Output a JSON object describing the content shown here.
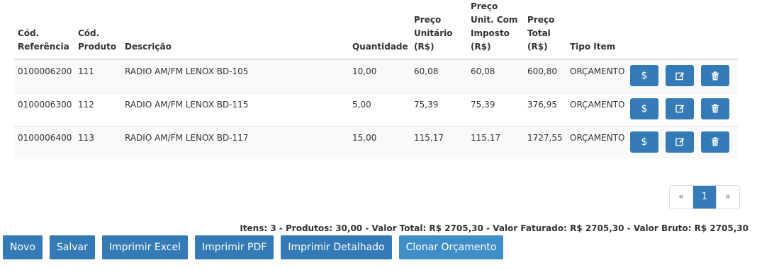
{
  "table": {
    "headers": {
      "ref": [
        "Cód.",
        "Referência"
      ],
      "prod": [
        "Cód.",
        "Produto"
      ],
      "desc": [
        "Descrição"
      ],
      "qty": [
        "Quantidade"
      ],
      "unit": [
        "Preço",
        "Unitário",
        "(R$)"
      ],
      "unit_tax": [
        "Preço",
        "Unit. Com",
        "Imposto",
        "(R$)"
      ],
      "total": [
        "Preço",
        "Total",
        "(R$)"
      ],
      "type": [
        "Tipo Item"
      ]
    },
    "rows": [
      {
        "ref": "0100006200",
        "prod": "111",
        "desc": "RADIO AM/FM LENOX BD-105",
        "qty": "10,00",
        "unit": "60,08",
        "unit_tax": "60,08",
        "total": "600,80",
        "type": "ORÇAMENTO"
      },
      {
        "ref": "0100006300",
        "prod": "112",
        "desc": "RADIO AM/FM LENOX BD-115",
        "qty": "5,00",
        "unit": "75,39",
        "unit_tax": "75,39",
        "total": "376,95",
        "type": "ORÇAMENTO"
      },
      {
        "ref": "0100006400",
        "prod": "113",
        "desc": "RADIO AM/FM LENOX BD-117",
        "qty": "15,00",
        "unit": "115,17",
        "unit_tax": "115,17",
        "total": "1727,55",
        "type": "ORÇAMENTO"
      }
    ],
    "row_actions": {
      "price_icon": "dollar-icon",
      "edit_icon": "edit-icon",
      "delete_icon": "trash-icon",
      "price_glyph": "$"
    }
  },
  "pagination": {
    "prev": "«",
    "current": "1",
    "next": "»"
  },
  "summary": "Itens: 3 - Produtos: 30,00 - Valor Total: R$ 2705,30 - Valor Faturado: R$ 2705,30 - Valor Bruto: R$ 2705,30",
  "buttons": {
    "novo": "Novo",
    "salvar": "Salvar",
    "imprimir_excel": "Imprimir Excel",
    "imprimir_pdf": "Imprimir PDF",
    "imprimir_detalhado": "Imprimir Detalhado",
    "clonar": "Clonar Orçamento"
  },
  "colors": {
    "primary": "#337ab7",
    "row_stripe": "#f9f9f9"
  }
}
